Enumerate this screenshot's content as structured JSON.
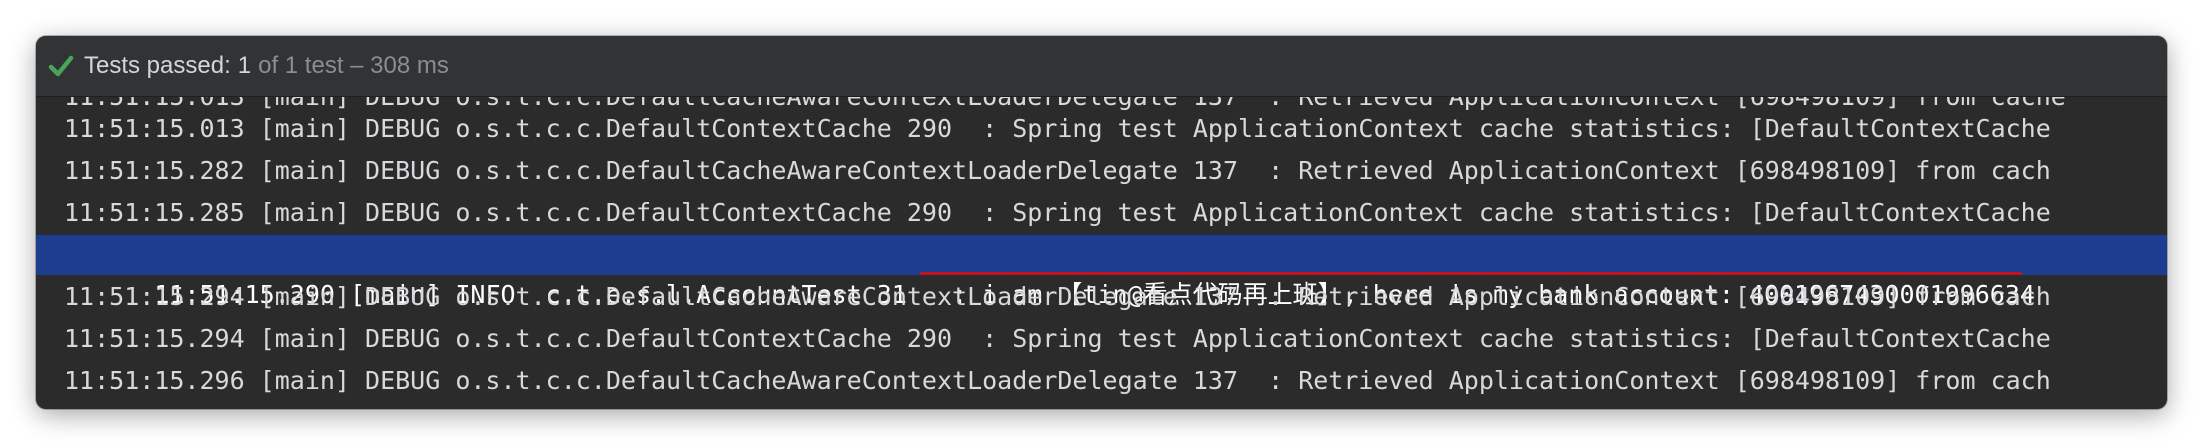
{
  "status": {
    "icon": "check-icon",
    "icon_color": "#4aa45a",
    "label": "Tests passed:",
    "count": "1",
    "detail": "of 1 test – 308 ms"
  },
  "console": {
    "lines": [
      {
        "text": "11:51:15.013 [main] DEBUG o.s.t.c.c.DefaultCacheAwareContextLoaderDelegate 137  : Retrieved ApplicationContext [698498109] from cache",
        "highlight": false,
        "partial": true
      },
      {
        "text": "11:51:15.013 [main] DEBUG o.s.t.c.c.DefaultContextCache 290  : Spring test ApplicationContext cache statistics: [DefaultContextCache",
        "highlight": false
      },
      {
        "text": "11:51:15.282 [main] DEBUG o.s.t.c.c.DefaultCacheAwareContextLoaderDelegate 137  : Retrieved ApplicationContext [698498109] from cach",
        "highlight": false
      },
      {
        "text": "11:51:15.285 [main] DEBUG o.s.t.c.c.DefaultContextCache 290  : Spring test ApplicationContext cache statistics: [DefaultContextCache",
        "highlight": false
      },
      {
        "text": "11:51:15.290 [main] INFO  c.t.e.s.l.AccountTest 31   : i am 【tin@看点代码再上班】, here is my bank account: 4001967430001996634",
        "highlight": true
      },
      {
        "text": "11:51:15.294 [main] DEBUG o.s.t.c.c.DefaultCacheAwareContextLoaderDelegate 137  : Retrieved ApplicationContext [698498109] from cach",
        "highlight": false
      },
      {
        "text": "11:51:15.294 [main] DEBUG o.s.t.c.c.DefaultContextCache 290  : Spring test ApplicationContext cache statistics: [DefaultContextCache",
        "highlight": false
      },
      {
        "text": "11:51:15.296 [main] DEBUG o.s.t.c.c.DefaultCacheAwareContextLoaderDelegate 137  : Retrieved ApplicationContext [698498109] from cach",
        "highlight": false
      }
    ],
    "highlight_color": "#1d3d91",
    "underline_color": "#c1121f"
  }
}
